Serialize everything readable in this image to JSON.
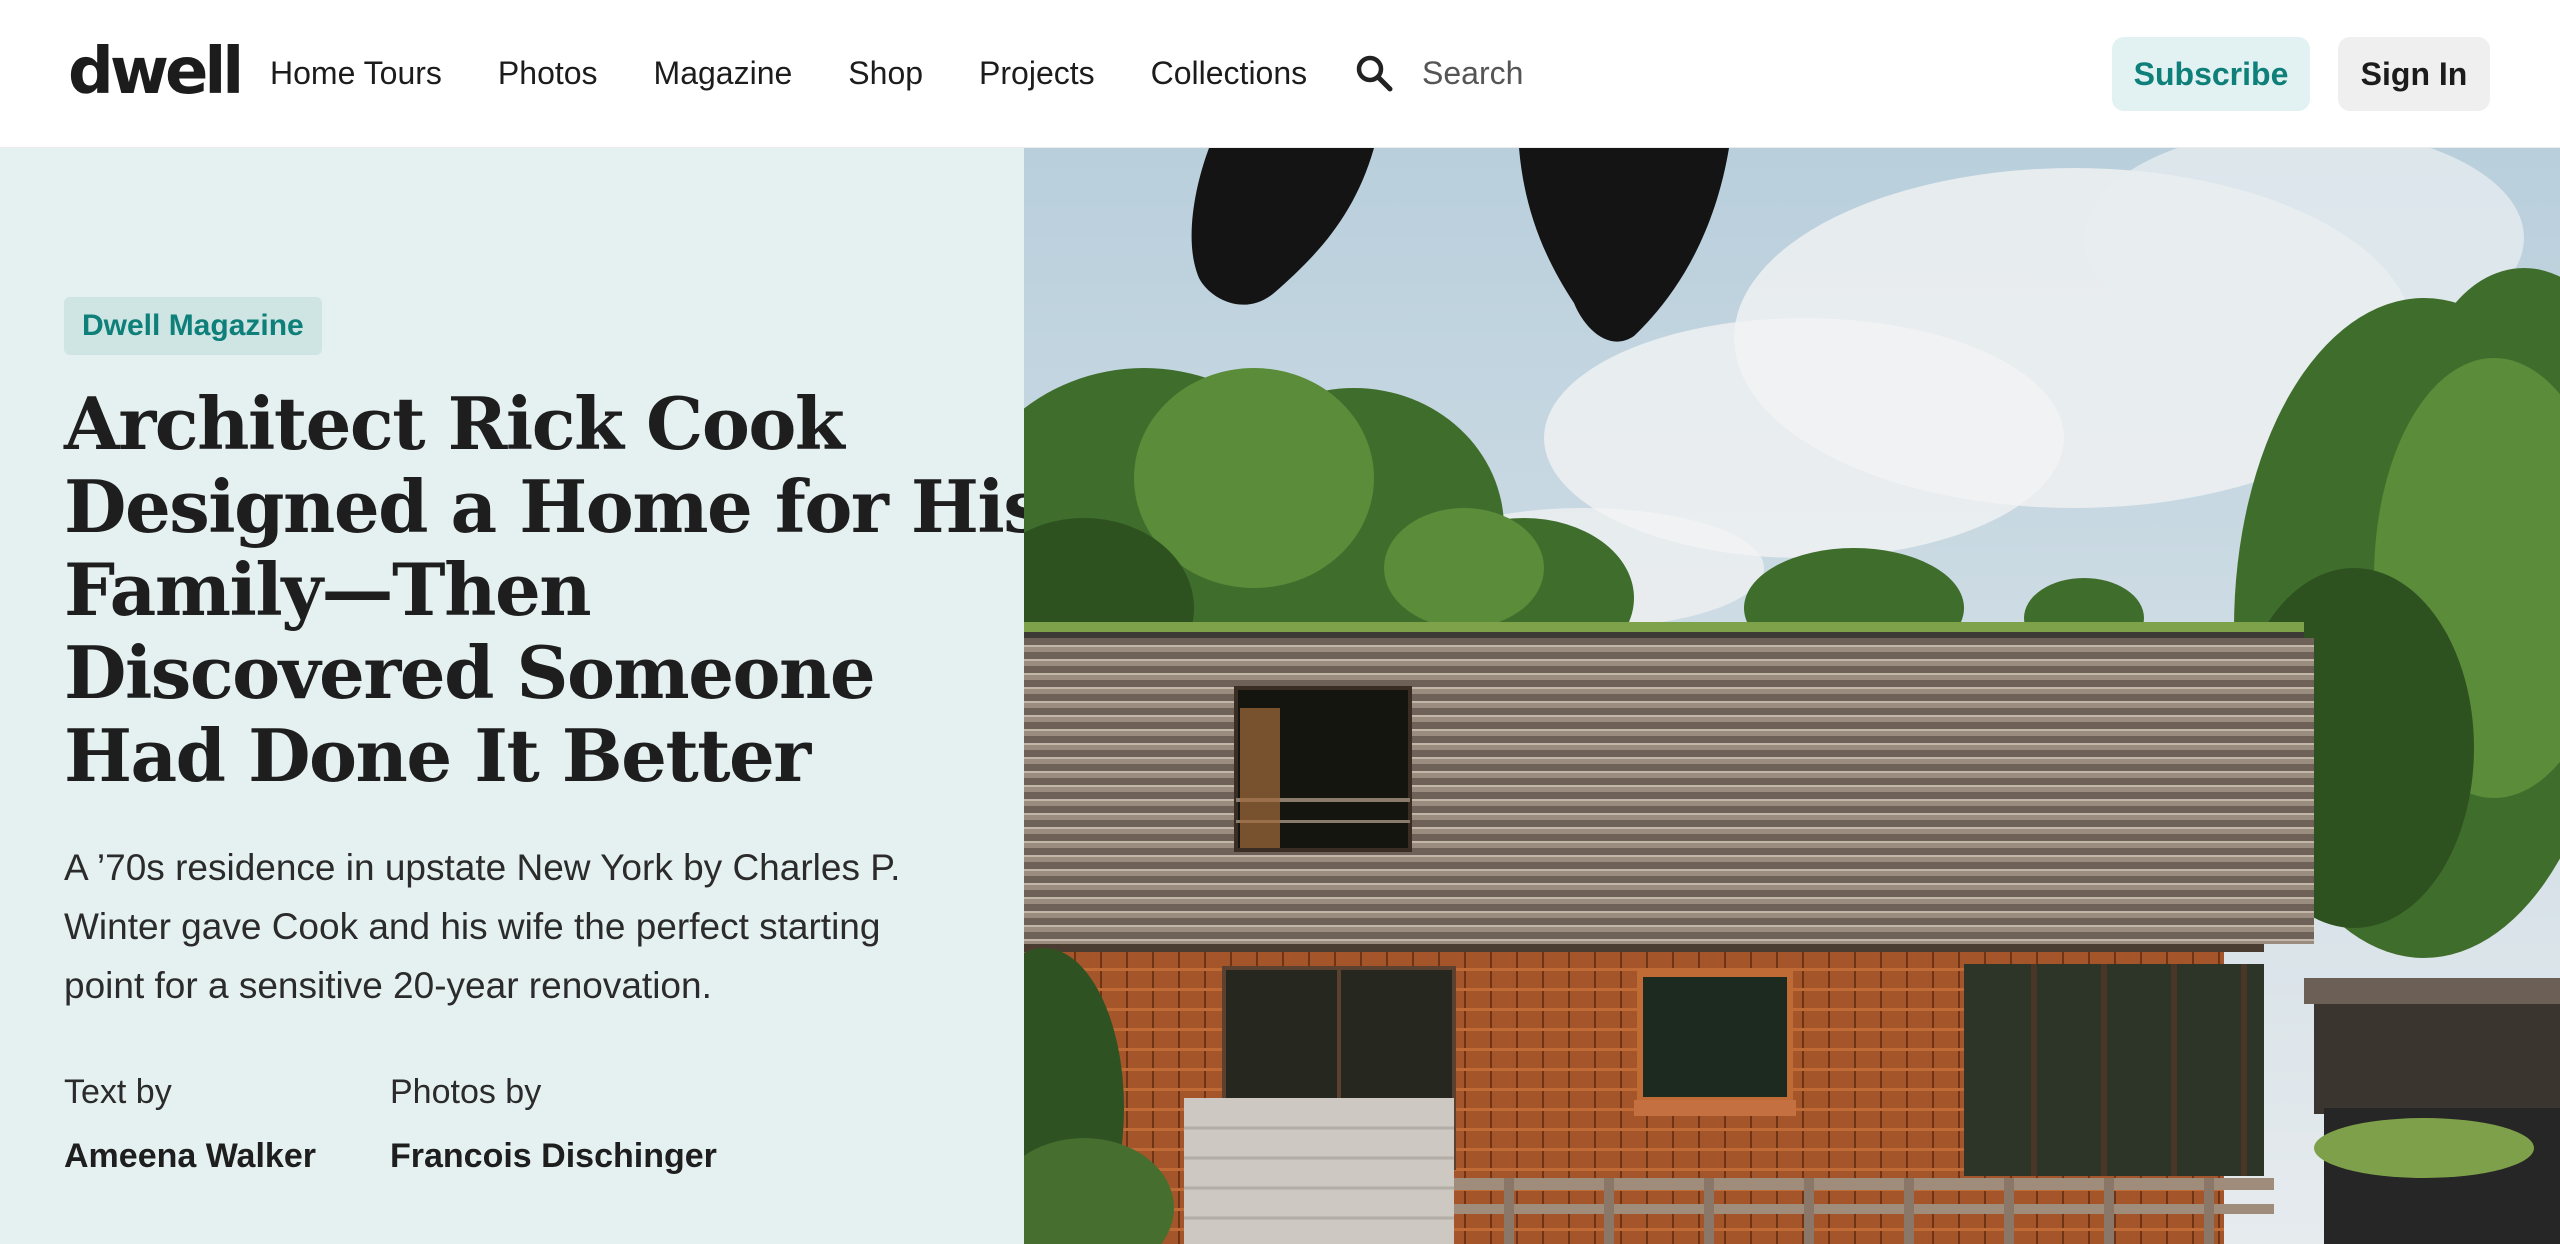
{
  "site": {
    "logo": "dwell"
  },
  "nav": {
    "items": [
      "Home Tours",
      "Photos",
      "Magazine",
      "Shop",
      "Projects",
      "Collections"
    ],
    "search_label": "Search",
    "subscribe_label": "Subscribe",
    "signin_label": "Sign In"
  },
  "article": {
    "tag": "Dwell Magazine",
    "headline_lines": [
      "Architect Rick Cook",
      "Designed a Home for His",
      "Family—Then",
      "Discovered Someone",
      "Had Done It Better"
    ],
    "dek_lines": [
      "A ’70s residence in upstate New York by Charles P.",
      "Winter gave Cook and his wife the perfect starting",
      "point for a sensitive 20-year renovation."
    ],
    "credits": [
      {
        "label": "Text by",
        "name": "Ameena Walker"
      },
      {
        "label": "Photos by",
        "name": "Francois Dischinger"
      }
    ]
  },
  "colors": {
    "accent": "#0e8079",
    "left_panel_bg": "#e5f0f0",
    "tag_bg": "#cfe5e4",
    "subscribe_bg": "#e2f1f1",
    "signin_bg": "#efefef"
  }
}
